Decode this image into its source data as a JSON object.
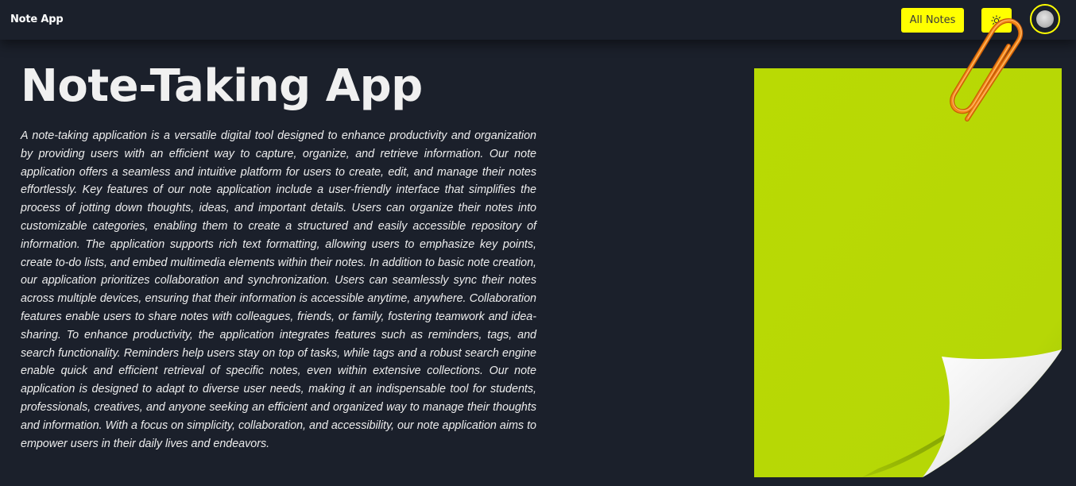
{
  "navbar": {
    "brand": "Note App",
    "all_notes_label": "All Notes",
    "theme_toggle_icon": "sun-icon",
    "avatar_icon": "user-avatar-icon"
  },
  "hero": {
    "title": "Note-Taking App",
    "description": "A note-taking application is a versatile digital tool designed to enhance productivity and organization by providing users with an efficient way to capture, organize, and retrieve information. Our note application offers a seamless and intuitive platform for users to create, edit, and manage their notes effortlessly. Key features of our note application include a user-friendly interface that simplifies the process of jotting down thoughts, ideas, and important details. Users can organize their notes into customizable categories, enabling them to create a structured and easily accessible repository of information. The application supports rich text formatting, allowing users to emphasize key points, create to-do lists, and embed multimedia elements within their notes. In addition to basic note creation, our application prioritizes collaboration and synchronization. Users can seamlessly sync their notes across multiple devices, ensuring that their information is accessible anytime, anywhere. Collaboration features enable users to share notes with colleagues, friends, or family, fostering teamwork and idea-sharing. To enhance productivity, the application integrates features such as reminders, tags, and search functionality. Reminders help users stay on top of tasks, while tags and a robust search engine enable quick and efficient retrieval of specific notes, even within extensive collections. Our note application is designed to adapt to diverse user needs, making it an indispensable tool for students, professionals, creatives, and anyone seeking an efficient and organized way to manage their thoughts and information. With a focus on simplicity, collaboration, and accessibility, our note application aims to empower users in their daily lives and endeavors."
  },
  "illustration": {
    "icon": "sticky-note-with-paperclip-icon",
    "note_color": "#b8d904",
    "clip_color": "#f07d14"
  },
  "colors": {
    "background": "#1b202b",
    "accent": "#ffff00"
  }
}
